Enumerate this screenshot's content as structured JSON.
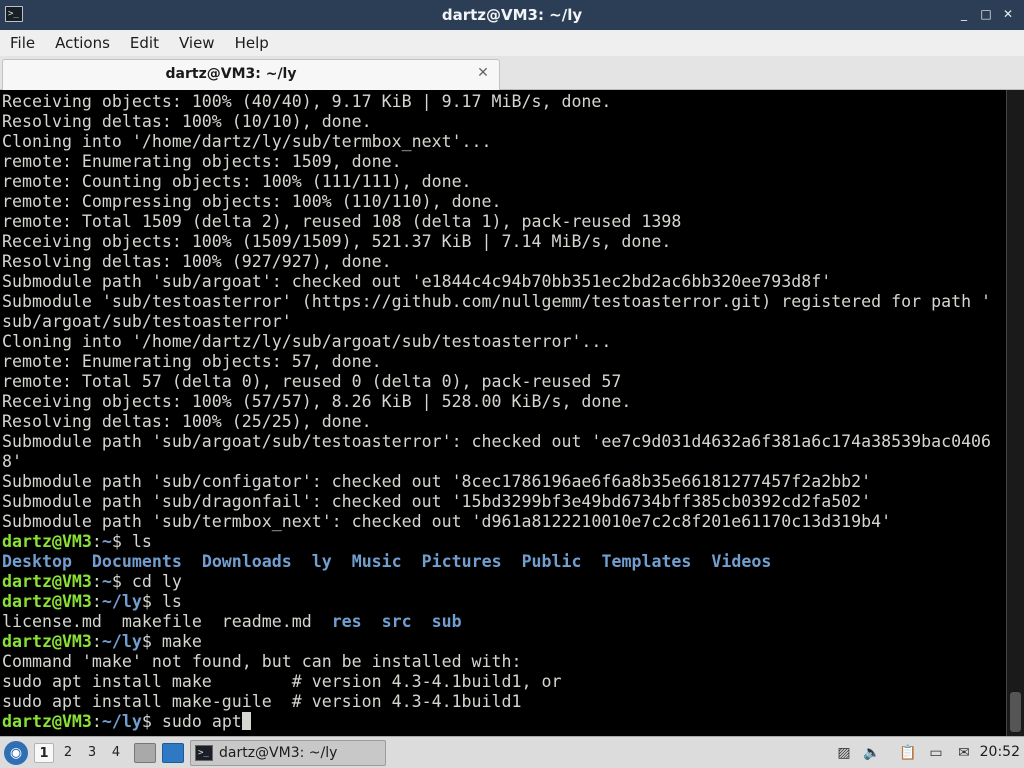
{
  "window": {
    "title": "dartz@VM3: ~/ly",
    "app_icon": ">_",
    "minimize_icon": "_",
    "maximize_icon": "□",
    "close_icon": "✕"
  },
  "menu": {
    "items": [
      "File",
      "Actions",
      "Edit",
      "View",
      "Help"
    ]
  },
  "tab": {
    "label": "dartz@VM3: ~/ly",
    "close_icon": "✕"
  },
  "terminal": {
    "colors": {
      "background": "#000000",
      "text": "#d3d7cf",
      "prompt_user": "#8ae234",
      "prompt_path": "#729fcf",
      "directory": "#729fcf"
    },
    "lines": [
      {
        "segs": [
          {
            "t": "Receiving objects: 100% (40/40), 9.17 KiB | 9.17 MiB/s, done."
          }
        ]
      },
      {
        "segs": [
          {
            "t": "Resolving deltas: 100% (10/10), done."
          }
        ]
      },
      {
        "segs": [
          {
            "t": "Cloning into '/home/dartz/ly/sub/termbox_next'..."
          }
        ]
      },
      {
        "segs": [
          {
            "t": "remote: Enumerating objects: 1509, done."
          }
        ]
      },
      {
        "segs": [
          {
            "t": "remote: Counting objects: 100% (111/111), done."
          }
        ]
      },
      {
        "segs": [
          {
            "t": "remote: Compressing objects: 100% (110/110), done."
          }
        ]
      },
      {
        "segs": [
          {
            "t": "remote: Total 1509 (delta 2), reused 108 (delta 1), pack-reused 1398"
          }
        ]
      },
      {
        "segs": [
          {
            "t": "Receiving objects: 100% (1509/1509), 521.37 KiB | 7.14 MiB/s, done."
          }
        ]
      },
      {
        "segs": [
          {
            "t": "Resolving deltas: 100% (927/927), done."
          }
        ]
      },
      {
        "segs": [
          {
            "t": "Submodule path 'sub/argoat': checked out 'e1844c4c94b70bb351ec2bd2ac6bb320ee793d8f'"
          }
        ]
      },
      {
        "segs": [
          {
            "t": "Submodule 'sub/testoasterror' (https://github.com/nullgemm/testoasterror.git) registered for path '"
          }
        ]
      },
      {
        "segs": [
          {
            "t": "sub/argoat/sub/testoasterror'"
          }
        ]
      },
      {
        "segs": [
          {
            "t": "Cloning into '/home/dartz/ly/sub/argoat/sub/testoasterror'..."
          }
        ]
      },
      {
        "segs": [
          {
            "t": "remote: Enumerating objects: 57, done."
          }
        ]
      },
      {
        "segs": [
          {
            "t": "remote: Total 57 (delta 0), reused 0 (delta 0), pack-reused 57"
          }
        ]
      },
      {
        "segs": [
          {
            "t": "Receiving objects: 100% (57/57), 8.26 KiB | 528.00 KiB/s, done."
          }
        ]
      },
      {
        "segs": [
          {
            "t": "Resolving deltas: 100% (25/25), done."
          }
        ]
      },
      {
        "segs": [
          {
            "t": "Submodule path 'sub/argoat/sub/testoasterror': checked out 'ee7c9d031d4632a6f381a6c174a38539bac0406"
          }
        ]
      },
      {
        "segs": [
          {
            "t": "8'"
          }
        ]
      },
      {
        "segs": [
          {
            "t": "Submodule path 'sub/configator': checked out '8cec1786196ae6f6a8b35e66181277457f2a2bb2'"
          }
        ]
      },
      {
        "segs": [
          {
            "t": "Submodule path 'sub/dragonfail': checked out '15bd3299bf3e49bd6734bff385cb0392cd2fa502'"
          }
        ]
      },
      {
        "segs": [
          {
            "t": "Submodule path 'sub/termbox_next': checked out 'd961a8122210010e7c2c8f201e61170c13d319b4'"
          }
        ]
      },
      {
        "segs": [
          {
            "t": "dartz@VM3",
            "c": "prompt-user"
          },
          {
            "t": ":"
          },
          {
            "t": "~",
            "c": "prompt-path"
          },
          {
            "t": "$ ls"
          }
        ]
      },
      {
        "segs": [
          {
            "t": "Desktop",
            "c": "dir-entry"
          },
          {
            "t": "  "
          },
          {
            "t": "Documents",
            "c": "dir-entry"
          },
          {
            "t": "  "
          },
          {
            "t": "Downloads",
            "c": "dir-entry"
          },
          {
            "t": "  "
          },
          {
            "t": "ly",
            "c": "dir-entry"
          },
          {
            "t": "  "
          },
          {
            "t": "Music",
            "c": "dir-entry"
          },
          {
            "t": "  "
          },
          {
            "t": "Pictures",
            "c": "dir-entry"
          },
          {
            "t": "  "
          },
          {
            "t": "Public",
            "c": "dir-entry"
          },
          {
            "t": "  "
          },
          {
            "t": "Templates",
            "c": "dir-entry"
          },
          {
            "t": "  "
          },
          {
            "t": "Videos",
            "c": "dir-entry"
          }
        ]
      },
      {
        "segs": [
          {
            "t": "dartz@VM3",
            "c": "prompt-user"
          },
          {
            "t": ":"
          },
          {
            "t": "~",
            "c": "prompt-path"
          },
          {
            "t": "$ cd ly"
          }
        ]
      },
      {
        "segs": [
          {
            "t": "dartz@VM3",
            "c": "prompt-user"
          },
          {
            "t": ":"
          },
          {
            "t": "~/ly",
            "c": "prompt-path"
          },
          {
            "t": "$ ls"
          }
        ]
      },
      {
        "segs": [
          {
            "t": "license.md  makefile  readme.md  "
          },
          {
            "t": "res",
            "c": "dir-entry"
          },
          {
            "t": "  "
          },
          {
            "t": "src",
            "c": "dir-entry"
          },
          {
            "t": "  "
          },
          {
            "t": "sub",
            "c": "dir-entry"
          }
        ]
      },
      {
        "segs": [
          {
            "t": "dartz@VM3",
            "c": "prompt-user"
          },
          {
            "t": ":"
          },
          {
            "t": "~/ly",
            "c": "prompt-path"
          },
          {
            "t": "$ make"
          }
        ]
      },
      {
        "segs": [
          {
            "t": "Command 'make' not found, but can be installed with:"
          }
        ]
      },
      {
        "segs": [
          {
            "t": "sudo apt install make        # version 4.3-4.1build1, or"
          }
        ]
      },
      {
        "segs": [
          {
            "t": "sudo apt install make-guile  # version 4.3-4.1build1"
          }
        ]
      },
      {
        "segs": [
          {
            "t": "dartz@VM3",
            "c": "prompt-user"
          },
          {
            "t": ":"
          },
          {
            "t": "~/ly",
            "c": "prompt-path"
          },
          {
            "t": "$ sudo apt"
          }
        ],
        "cursor": true
      }
    ]
  },
  "taskbar": {
    "workspaces": [
      "1",
      "2",
      "3",
      "4"
    ],
    "active_workspace": "1",
    "task": {
      "label": "dartz@VM3: ~/ly",
      "icon": ">_"
    },
    "tray_icons": [
      "screenshot-icon",
      "volume-icon",
      "clipboard-icon",
      "network-icon",
      "notification-icon"
    ],
    "clock": "20:52"
  }
}
